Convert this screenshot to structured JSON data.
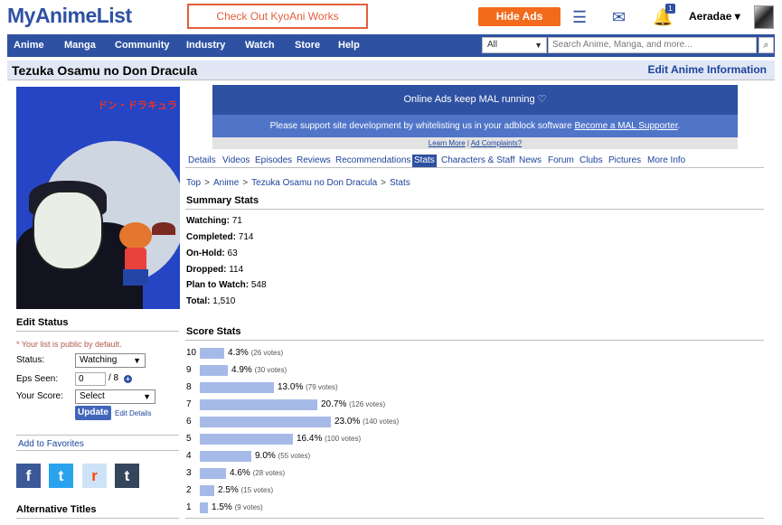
{
  "topbar": {
    "logo": "MyAnimeList",
    "promo": "Check Out KyoAni Works",
    "hide_ads": "Hide Ads",
    "notification_count": "1",
    "username": "Aeradae"
  },
  "nav": {
    "items": [
      "Anime",
      "Manga",
      "Community",
      "Industry",
      "Watch",
      "Store",
      "Help"
    ],
    "search_category": "All",
    "search_placeholder": "Search Anime, Manga, and more..."
  },
  "title": {
    "name": "Tezuka Osamu no Don Dracula",
    "edit": "Edit Anime Information"
  },
  "cover": {
    "title_text": "ドン・ドラキュラ"
  },
  "sidebar": {
    "edit_status_heading": "Edit Status",
    "public_note": "* Your list is public by default.",
    "status_label": "Status:",
    "status_value": "Watching",
    "eps_label": "Eps Seen:",
    "eps_value": "0",
    "eps_total": "/ 8",
    "score_label": "Your Score:",
    "score_value": "Select",
    "update_button": "Update",
    "edit_details": "Edit Details",
    "add_favorites": "Add to Favorites",
    "social": [
      "f",
      "t",
      "r",
      "t"
    ],
    "alt_titles_heading": "Alternative Titles"
  },
  "ad": {
    "banner": "Online Ads keep MAL running",
    "support_text": "Please support site development by whitelisting us in your adblock software",
    "support_link": "Become a MAL Supporter",
    "support_end": ".",
    "learn_more": "Learn More",
    "separator": "|",
    "complaints": "Ad Complaints?"
  },
  "tabs": [
    "Details",
    "Videos",
    "Episodes",
    "Reviews",
    "Recommendations",
    "Stats",
    "Characters & Staff",
    "News",
    "Forum",
    "Clubs",
    "Pictures",
    "More Info"
  ],
  "active_tab": "Stats",
  "breadcrumb": [
    "Top",
    "Anime",
    "Tezuka Osamu no Don Dracula",
    "Stats"
  ],
  "summary": {
    "heading": "Summary Stats",
    "rows": [
      {
        "label": "Watching:",
        "value": "71"
      },
      {
        "label": "Completed:",
        "value": "714"
      },
      {
        "label": "On-Hold:",
        "value": "63"
      },
      {
        "label": "Dropped:",
        "value": "114"
      },
      {
        "label": "Plan to Watch:",
        "value": "548"
      },
      {
        "label": "Total:",
        "value": "1,510"
      }
    ]
  },
  "scores": {
    "heading": "Score Stats",
    "rows": [
      {
        "score": "10",
        "pct": 4.3,
        "pct_text": "4.3%",
        "votes": "(26 votes)"
      },
      {
        "score": "9",
        "pct": 4.9,
        "pct_text": "4.9%",
        "votes": "(30 votes)"
      },
      {
        "score": "8",
        "pct": 13.0,
        "pct_text": "13.0%",
        "votes": "(79 votes)"
      },
      {
        "score": "7",
        "pct": 20.7,
        "pct_text": "20.7%",
        "votes": "(126 votes)"
      },
      {
        "score": "6",
        "pct": 23.0,
        "pct_text": "23.0%",
        "votes": "(140 votes)"
      },
      {
        "score": "5",
        "pct": 16.4,
        "pct_text": "16.4%",
        "votes": "(100 votes)"
      },
      {
        "score": "4",
        "pct": 9.0,
        "pct_text": "9.0%",
        "votes": "(55 votes)"
      },
      {
        "score": "3",
        "pct": 4.6,
        "pct_text": "4.6%",
        "votes": "(28 votes)"
      },
      {
        "score": "2",
        "pct": 2.5,
        "pct_text": "2.5%",
        "votes": "(15 votes)"
      },
      {
        "score": "1",
        "pct": 1.5,
        "pct_text": "1.5%",
        "votes": "(9 votes)"
      }
    ]
  },
  "colors": {
    "brand": "#2e51a2",
    "accent_orange": "#f26b1d",
    "bar": "#a6bae8"
  }
}
